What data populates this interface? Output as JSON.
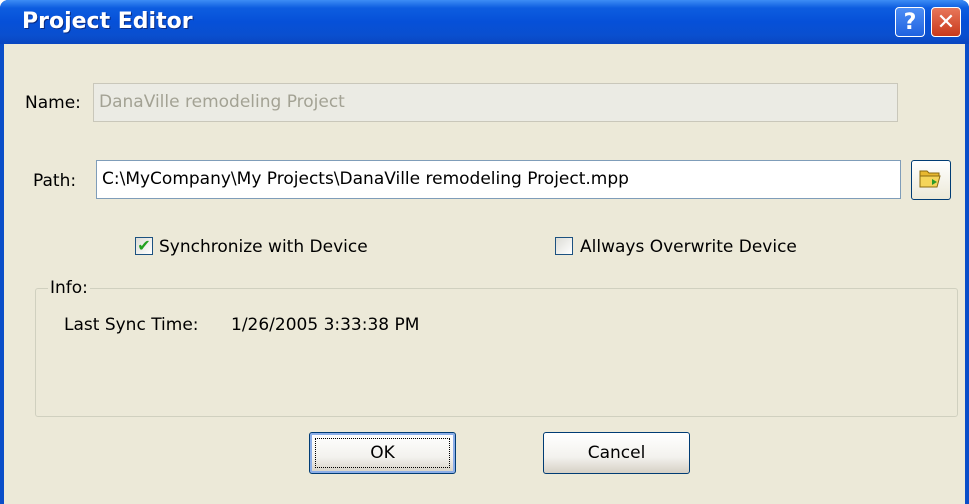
{
  "window": {
    "title": "Project Editor",
    "help_glyph": "?",
    "close_glyph": "✕"
  },
  "form": {
    "name_label": "Name:",
    "name_value": "DanaVille remodeling Project",
    "path_label": "Path:",
    "path_value": "C:\\MyCompany\\My Projects\\DanaVille remodeling Project.mpp",
    "browse_icon": "folder-open-icon"
  },
  "options": {
    "sync_label": "Synchronize with Device",
    "sync_checked": true,
    "overwrite_label": "Allways Overwrite Device",
    "overwrite_checked": false
  },
  "info": {
    "legend": "Info:",
    "last_sync_label": "Last Sync Time:",
    "last_sync_value": "1/26/2005 3:33:38 PM"
  },
  "buttons": {
    "ok_label": "OK",
    "cancel_label": "Cancel"
  },
  "colors": {
    "titlebar": "#0650d8",
    "dialog_bg": "#ece9d8",
    "close_red": "#c8391c"
  }
}
